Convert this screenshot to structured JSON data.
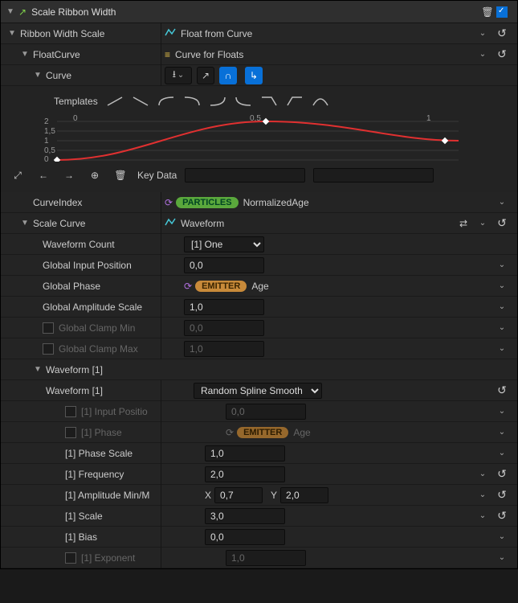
{
  "header": {
    "title": "Scale Ribbon Width"
  },
  "ribbon_width_scale": {
    "label": "Ribbon Width Scale",
    "value_label": "Float from Curve"
  },
  "float_curve": {
    "label": "FloatCurve",
    "value_label": "Curve for Floats",
    "curve_label": "Curve",
    "templates_label": "Templates",
    "key_data_label": "Key Data"
  },
  "chart_data": {
    "type": "line",
    "title": "",
    "xlabel": "",
    "ylabel": "",
    "xlim": [
      0,
      1
    ],
    "ylim": [
      0,
      2
    ],
    "y_ticks": [
      0,
      0.5,
      1,
      1.5,
      2
    ],
    "x_ticks": [
      0,
      0.5,
      1
    ],
    "series": [
      {
        "name": "curve",
        "color": "#e03030",
        "points": [
          {
            "x": 0.0,
            "y": 0.0,
            "key": true
          },
          {
            "x": 0.5,
            "y": 2.0,
            "key": true
          },
          {
            "x": 1.0,
            "y": 1.0,
            "key": true
          }
        ]
      }
    ]
  },
  "curve_index": {
    "label": "CurveIndex",
    "tag": "PARTICLES",
    "value": "NormalizedAge"
  },
  "scale_curve": {
    "label": "Scale Curve",
    "value_label": "Waveform"
  },
  "wf": {
    "count": {
      "label": "Waveform Count",
      "value": "[1] One"
    },
    "gip": {
      "label": "Global Input Position",
      "value": "0,0"
    },
    "gphase": {
      "label": "Global Phase",
      "tag": "EMITTER",
      "value": "Age"
    },
    "gamp": {
      "label": "Global Amplitude Scale",
      "value": "1,0"
    },
    "gcmin": {
      "label": "Global Clamp Min",
      "value": "0,0"
    },
    "gcmax": {
      "label": "Global Clamp Max",
      "value": "1,0"
    },
    "group": {
      "label": "Waveform [1]"
    },
    "type": {
      "label": "Waveform [1]",
      "value": "Random Spline Smooth"
    },
    "ipos": {
      "label": "[1] Input Positio",
      "value": "0,0"
    },
    "phase": {
      "label": "[1] Phase",
      "tag": "EMITTER",
      "value": "Age"
    },
    "pscale": {
      "label": "[1] Phase Scale",
      "value": "1,0"
    },
    "freq": {
      "label": "[1] Frequency",
      "value": "2,0"
    },
    "amp": {
      "label": "[1] Amplitude Min/M",
      "x_label": "X",
      "x": "0,7",
      "y_label": "Y",
      "y": "2,0"
    },
    "scale": {
      "label": "[1] Scale",
      "value": "3,0"
    },
    "bias": {
      "label": "[1] Bias",
      "value": "0,0"
    },
    "exp": {
      "label": "[1] Exponent",
      "value": "1,0"
    }
  }
}
